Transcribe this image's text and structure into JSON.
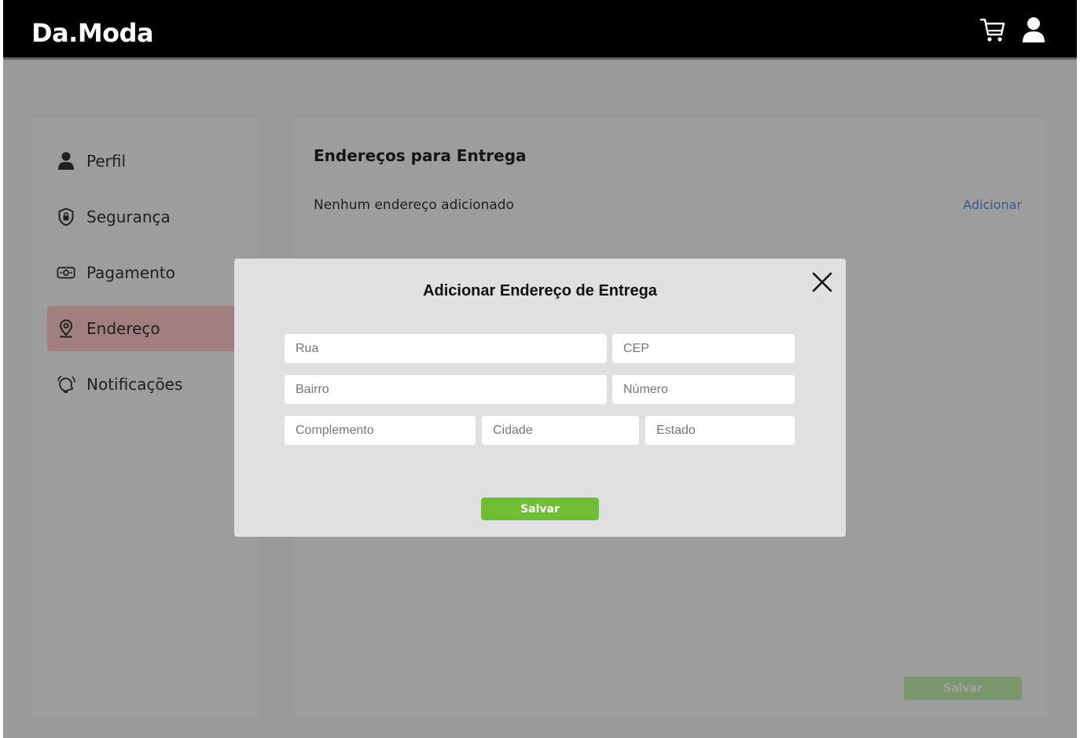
{
  "header": {
    "logo": "Da.Moda",
    "cart_icon": "cart-icon",
    "user_icon": "user-icon"
  },
  "sidebar": {
    "items": [
      {
        "label": "Perfil",
        "icon": "user-icon",
        "active": false
      },
      {
        "label": "Segurança",
        "icon": "shield-icon",
        "active": false
      },
      {
        "label": "Pagamento",
        "icon": "money-icon",
        "active": false
      },
      {
        "label": "Endereço",
        "icon": "location-pin-icon",
        "active": true
      },
      {
        "label": "Notificações",
        "icon": "bell-icon",
        "active": false
      }
    ]
  },
  "main": {
    "title": "Endereços para Entrega",
    "empty_message": "Nenhum endereço adicionado",
    "add_link": "Adicionar",
    "save_label": "Salvar"
  },
  "modal": {
    "title": "Adicionar Endereço de Entrega",
    "close_icon": "close-icon",
    "fields": {
      "rua": {
        "placeholder": "Rua",
        "value": ""
      },
      "cep": {
        "placeholder": "CEP",
        "value": ""
      },
      "bairro": {
        "placeholder": "Bairro",
        "value": ""
      },
      "numero": {
        "placeholder": "Número",
        "value": ""
      },
      "complemento": {
        "placeholder": "Complemento",
        "value": ""
      },
      "cidade": {
        "placeholder": "Cidade",
        "value": ""
      },
      "estado": {
        "placeholder": "Estado",
        "value": ""
      }
    },
    "save_label": "Salvar"
  },
  "colors": {
    "header_bg": "#000000",
    "active_item_bg": "#ffc9c9",
    "link": "#5b8fe0",
    "save_button": "#6fbe36",
    "overlay": "rgba(0,0,0,0.365)"
  }
}
